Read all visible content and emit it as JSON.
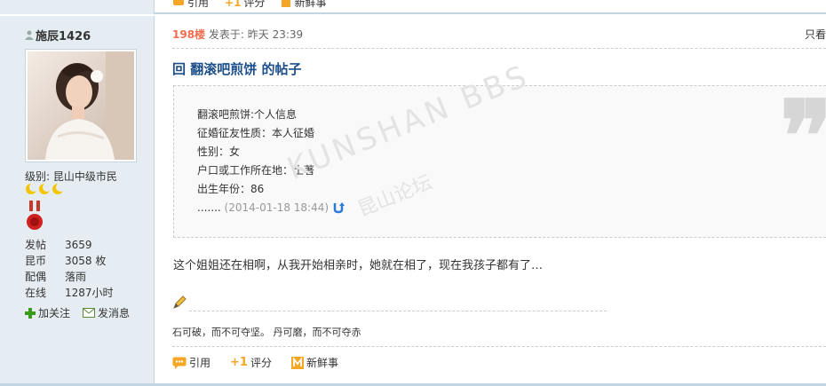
{
  "top_actions": {
    "reply": "引用",
    "rate": "评分",
    "news": "新鲜事"
  },
  "user": {
    "name": "施辰1426",
    "level": "级别: 昆山中级市民",
    "stats": [
      {
        "key": "发帖",
        "value": "3659"
      },
      {
        "key": "昆币",
        "value": "3058 枚"
      },
      {
        "key": "配偶",
        "value": "落雨"
      },
      {
        "key": "在线",
        "value": "1287小时"
      }
    ],
    "follow": "加关注",
    "message": "发消息"
  },
  "post": {
    "floor": "198楼",
    "posted": "发表于: 昨天 23:39",
    "only_author": "只看",
    "title": "回 翻滚吧煎饼 的帖子",
    "quote_lines": [
      "翻滚吧煎饼:个人信息",
      "征婚征友性质：本人征婚",
      "性别：女",
      "户口或工作所在地：土著",
      "出生年份：86"
    ],
    "quote_ellipsis": ".......",
    "quote_time": "(2014-01-18 18:44)",
    "body": "这个姐姐还在相啊，从我开始相亲时，她就在相了，现在我孩子都有了…",
    "signature": "石可破，而不可夺坚。 丹可磨，而不可夺赤",
    "actions": {
      "reply": "引用",
      "rate": "评分",
      "news": "新鲜事"
    }
  },
  "watermark": {
    "en": "KUNSHAN BBS",
    "zh": "昆山论坛"
  }
}
